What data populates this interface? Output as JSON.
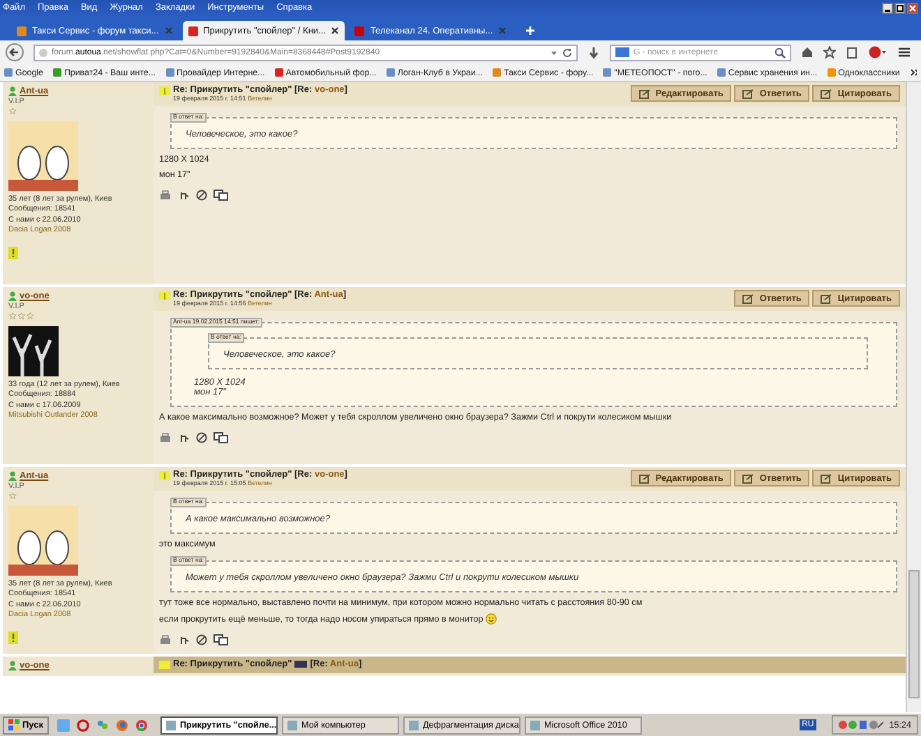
{
  "menu": [
    "Файл",
    "Правка",
    "Вид",
    "Журнал",
    "Закладки",
    "Инструменты",
    "Справка"
  ],
  "tabs": [
    {
      "label": "Такси Сервис - форум такси...",
      "selected": false
    },
    {
      "label": "Прикрутить \"спойлер\" / Кни...",
      "selected": true
    },
    {
      "label": "Телеканал 24. Оперативны...",
      "selected": false
    }
  ],
  "address": "forum.**autoua**.net/showflat.php?Cat=0&Number=9192840&Main=8368448#Post9192840",
  "search": {
    "placeholder": "G - поиск в интернете"
  },
  "bookmarks": [
    "Google",
    "Приват24 - Ваш инте...",
    "Провайдер Интерне...",
    "Автомобильный фор...",
    "Логан-Клуб в Украи...",
    "Такси Сервис - фору...",
    "\"МЕТЕОПОСТ\" - пого...",
    "Сервис хранения ин...",
    "Одноклассники"
  ],
  "posts": [
    {
      "kind": "cartoon",
      "author": "Ant-ua",
      "rank": "V.I.P",
      "rank_stars": "☆",
      "info": [
        "35 лет (8 лет за рулем), Киев",
        "Сообщения: 18541",
        "С нами с 22.06.2010"
      ],
      "car": "Dacia Logan 2008",
      "warning": true,
      "title": "Re: Прикрутить \"спойлер\" [Re: ",
      "reply_to": "vo-one",
      "title_end": "]",
      "date": "19 февраля 2015 г. 14:51",
      "date_note": "Ветелин",
      "buttons": [
        "Редактировать",
        "Ответить",
        "Цитировать"
      ],
      "body": [
        {
          "kind": "quote",
          "label": "В ответ на:",
          "text": "Человеческое, это какое?"
        },
        {
          "kind": "text",
          "text": "1280 X 1024"
        },
        {
          "kind": "text",
          "text": "мон 17\""
        }
      ]
    },
    {
      "kind": "dark",
      "author": "vo-one",
      "rank": "V.I.P",
      "rank_stars": "☆☆☆",
      "info": [
        "33 года (12 лет за рулем), Киев",
        "Сообщения: 18884",
        "С нами с 17.06.2009"
      ],
      "car": "Mitsubishi Outlander 2008",
      "warning": false,
      "title": "Re: Прикрутить \"спойлер\" [Re: ",
      "reply_to": "Ant-ua",
      "title_end": "]",
      "date": "19 февраля 2015 г. 14:56",
      "date_note": "Ветелин",
      "buttons": [
        "Ответить",
        "Цитировать"
      ],
      "body": [
        {
          "kind": "nested",
          "label": "Ant-ua 19.02.2015 14:51 пишет:",
          "quote_label": "В ответ на:",
          "quote": "Человеческое, это какое?",
          "lines": [
            "1280 X 1024",
            "мон 17\""
          ]
        },
        {
          "kind": "text",
          "text": "А какое максимально возможное? Может у тебя скроллом увеличено окно браузера? Зажми Ctrl и покрути колесиком мышки"
        }
      ]
    },
    {
      "kind": "cartoon",
      "author": "Ant-ua",
      "rank": "V.I.P",
      "rank_stars": "☆",
      "info": [
        "35 лет (8 лет за рулем), Киев",
        "Сообщения: 18541",
        "С нами с 22.06.2010"
      ],
      "car": "Dacia Logan 2008",
      "warning": true,
      "title": "Re: Прикрутить \"спойлер\" [Re: ",
      "reply_to": "vo-one",
      "title_end": "]",
      "date": "19 февраля 2015 г. 15:05",
      "date_note": "Ветелин",
      "buttons": [
        "Редактировать",
        "Ответить",
        "Цитировать"
      ],
      "body": [
        {
          "kind": "quote",
          "label": "В ответ на:",
          "text": "А какое максимально возможное?"
        },
        {
          "kind": "text",
          "text": "это максимум"
        },
        {
          "kind": "quote",
          "label": "В ответ на:",
          "text": "Может у тебя скроллом увеличено окно браузера? Зажми Ctrl и покрути колесиком мышки"
        },
        {
          "kind": "text",
          "text": "тут тоже все нормально, выставлено почти на минимум, при котором можно нормально читать с расстояния 80-90 см"
        },
        {
          "kind": "smile",
          "text": "если прокрутить ещё меньше, то тогда надо носом упираться прямо в монитор"
        }
      ]
    }
  ],
  "partial_post": {
    "author": "vo-one",
    "title": "Re: Прикрутить \"спойлер\"",
    "title_re": "[Re: ",
    "reply_to": "Ant-ua",
    "title_end": "]"
  },
  "taskbar": {
    "start": "Пуск",
    "tasks": [
      {
        "label": "Прикрутить \"спойле...",
        "selected": true
      },
      {
        "label": "Мой компьютер",
        "selected": false
      },
      {
        "label": "Дефрагментация диска",
        "selected": false
      },
      {
        "label": "Microsoft Office 2010",
        "selected": false
      }
    ],
    "lang": "RU",
    "clock": "15:24"
  }
}
